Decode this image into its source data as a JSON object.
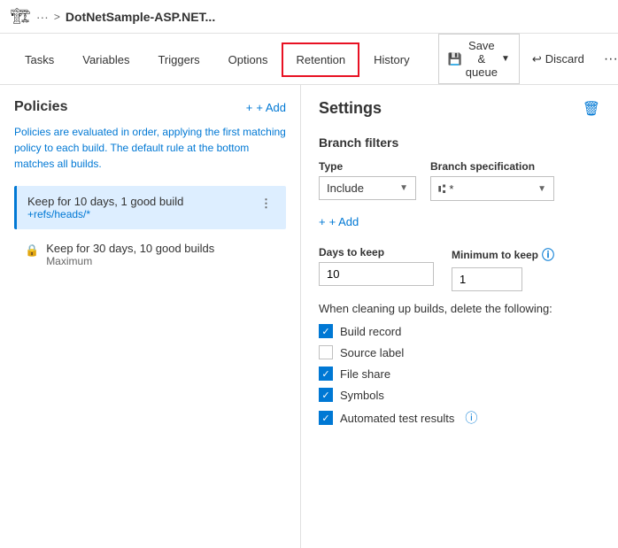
{
  "header": {
    "icon": "🏗",
    "dots": "···",
    "chevron": ">",
    "title": "DotNetSample-ASP.NET..."
  },
  "tabs": {
    "items": [
      {
        "label": "Tasks",
        "active": false
      },
      {
        "label": "Variables",
        "active": false
      },
      {
        "label": "Triggers",
        "active": false
      },
      {
        "label": "Options",
        "active": false
      },
      {
        "label": "Retention",
        "active": true
      },
      {
        "label": "History",
        "active": false
      }
    ],
    "save_label": "Save & queue",
    "discard_label": "Discard"
  },
  "left": {
    "title": "Policies",
    "add_label": "+ Add",
    "description": "Policies are evaluated in order, applying the first matching policy to each build. The default rule at the bottom matches all builds.",
    "policies": [
      {
        "name": "Keep for 10 days, 1 good build",
        "sub": "+refs/heads/*",
        "selected": true
      }
    ],
    "locked": {
      "name": "Keep for 30 days, 10 good builds",
      "sub": "Maximum"
    }
  },
  "right": {
    "title": "Settings",
    "branch_filters_title": "Branch filters",
    "type_label": "Type",
    "type_value": "Include",
    "branch_spec_label": "Branch specification",
    "branch_spec_value": "*",
    "add_filter_label": "+ Add",
    "days_label": "Days to keep",
    "days_value": "10",
    "min_label": "Minimum to keep",
    "min_value": "1",
    "cleanup_text": "When cleaning up builds, delete the following:",
    "checkboxes": [
      {
        "label": "Build record",
        "checked": true
      },
      {
        "label": "Source label",
        "checked": false
      },
      {
        "label": "File share",
        "checked": true
      },
      {
        "label": "Symbols",
        "checked": true
      },
      {
        "label": "Automated test results",
        "checked": true,
        "info": true
      }
    ]
  }
}
